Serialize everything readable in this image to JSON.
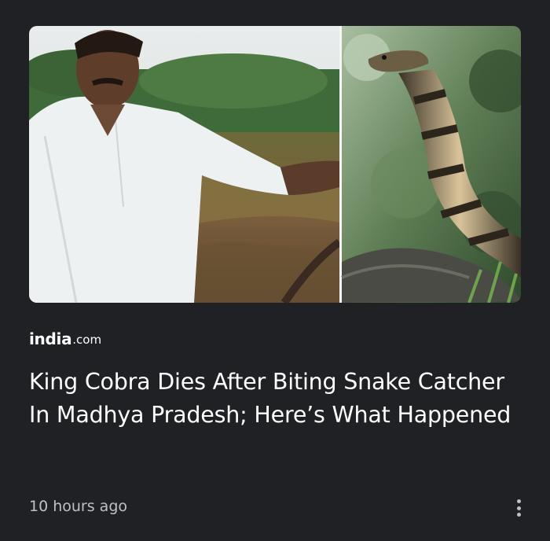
{
  "article": {
    "source": {
      "name": "india",
      "suffix": ".com"
    },
    "headline": "King Cobra Dies After Biting Snake Catcher In Madhya Pradesh; Here’s What Happened",
    "timestamp": "10 hours ago"
  },
  "icons": {
    "more": "more-vert-icon"
  },
  "colors": {
    "background": "#202124",
    "headline": "#ffffff",
    "secondary_text": "#bdc1c6"
  }
}
